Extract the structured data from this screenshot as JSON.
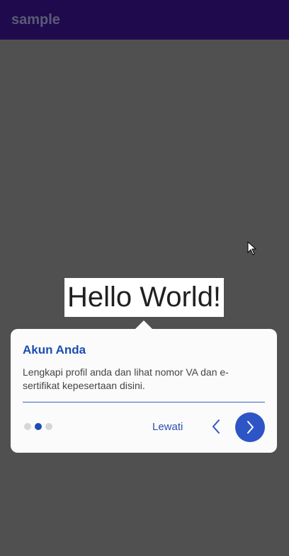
{
  "appbar": {
    "title": "sample"
  },
  "main": {
    "hello_text": "Hello World!"
  },
  "tooltip": {
    "title": "Akun Anda",
    "description": "Lengkapi profil anda dan lihat nomor VA dan e-sertifikat kepesertaan disini.",
    "skip_label": "Lewati",
    "pager": {
      "total": 3,
      "current": 2
    },
    "icons": {
      "prev": "chevron-left-icon",
      "next": "chevron-right-icon"
    }
  },
  "colors": {
    "appbar": "#1f0a4e",
    "accent": "#1d4db0",
    "next_button": "#2d55c6",
    "overlay": "#505050"
  }
}
